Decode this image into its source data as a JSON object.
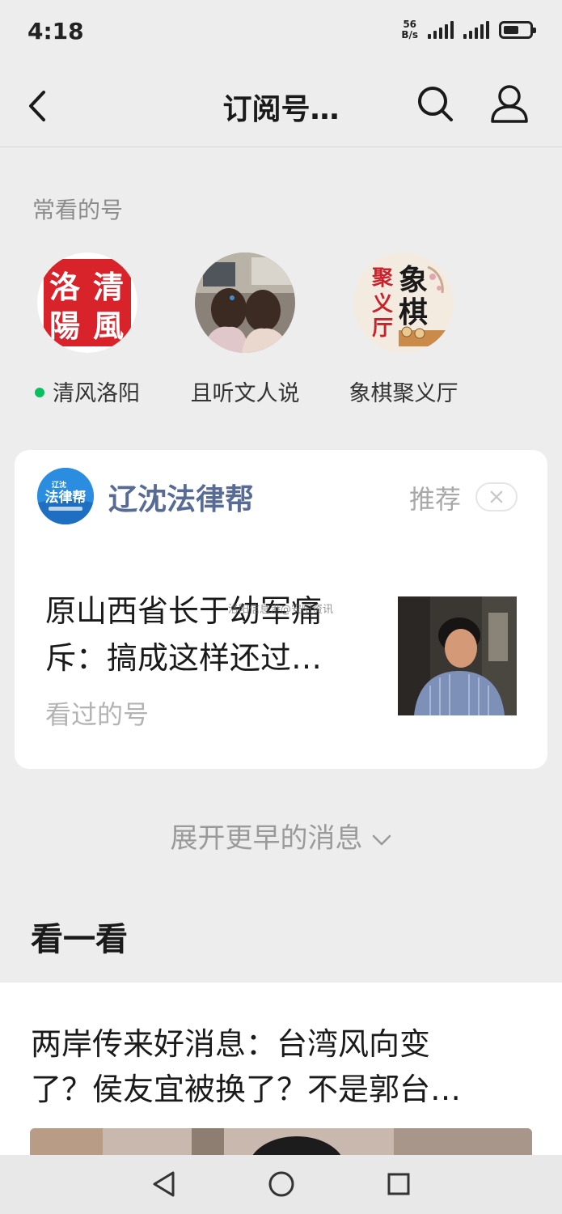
{
  "status_bar": {
    "time": "4:18",
    "net_speed_value": "56",
    "net_speed_unit": "B/s",
    "battery_level": 0.6
  },
  "nav": {
    "title": "订阅号…"
  },
  "frequent": {
    "heading": "常看的号",
    "items": [
      {
        "name": "清风洛阳",
        "logo_chars": [
          "洛",
          "清",
          "陽",
          "風"
        ],
        "online": true
      },
      {
        "name": "且听文人说",
        "online": false
      },
      {
        "name": "象棋聚义厅",
        "logo_chars": [
          "聚",
          "象",
          "义",
          "棋",
          "厅"
        ],
        "online": false
      }
    ]
  },
  "card": {
    "source": "辽沈法律帮",
    "source_logo": "法律帮",
    "source_logo_top": "辽沈",
    "recommend": "推荐",
    "title_line1": "原山西省长于幼军痛",
    "title_line2": "斥：搞成这样还过…",
    "subtitle": "看过的号",
    "watermark": "洛阳信息港@安阳资讯"
  },
  "expand": {
    "label": "展开更早的消息"
  },
  "look": {
    "heading": "看一看",
    "article_title_line1": "两岸传来好消息：台湾风向变",
    "article_title_line2": "了？侯友宜被换了？不是郭台…"
  },
  "colors": {
    "background": "#ededed",
    "link_blue": "#576b95",
    "online_green": "#07c160"
  }
}
